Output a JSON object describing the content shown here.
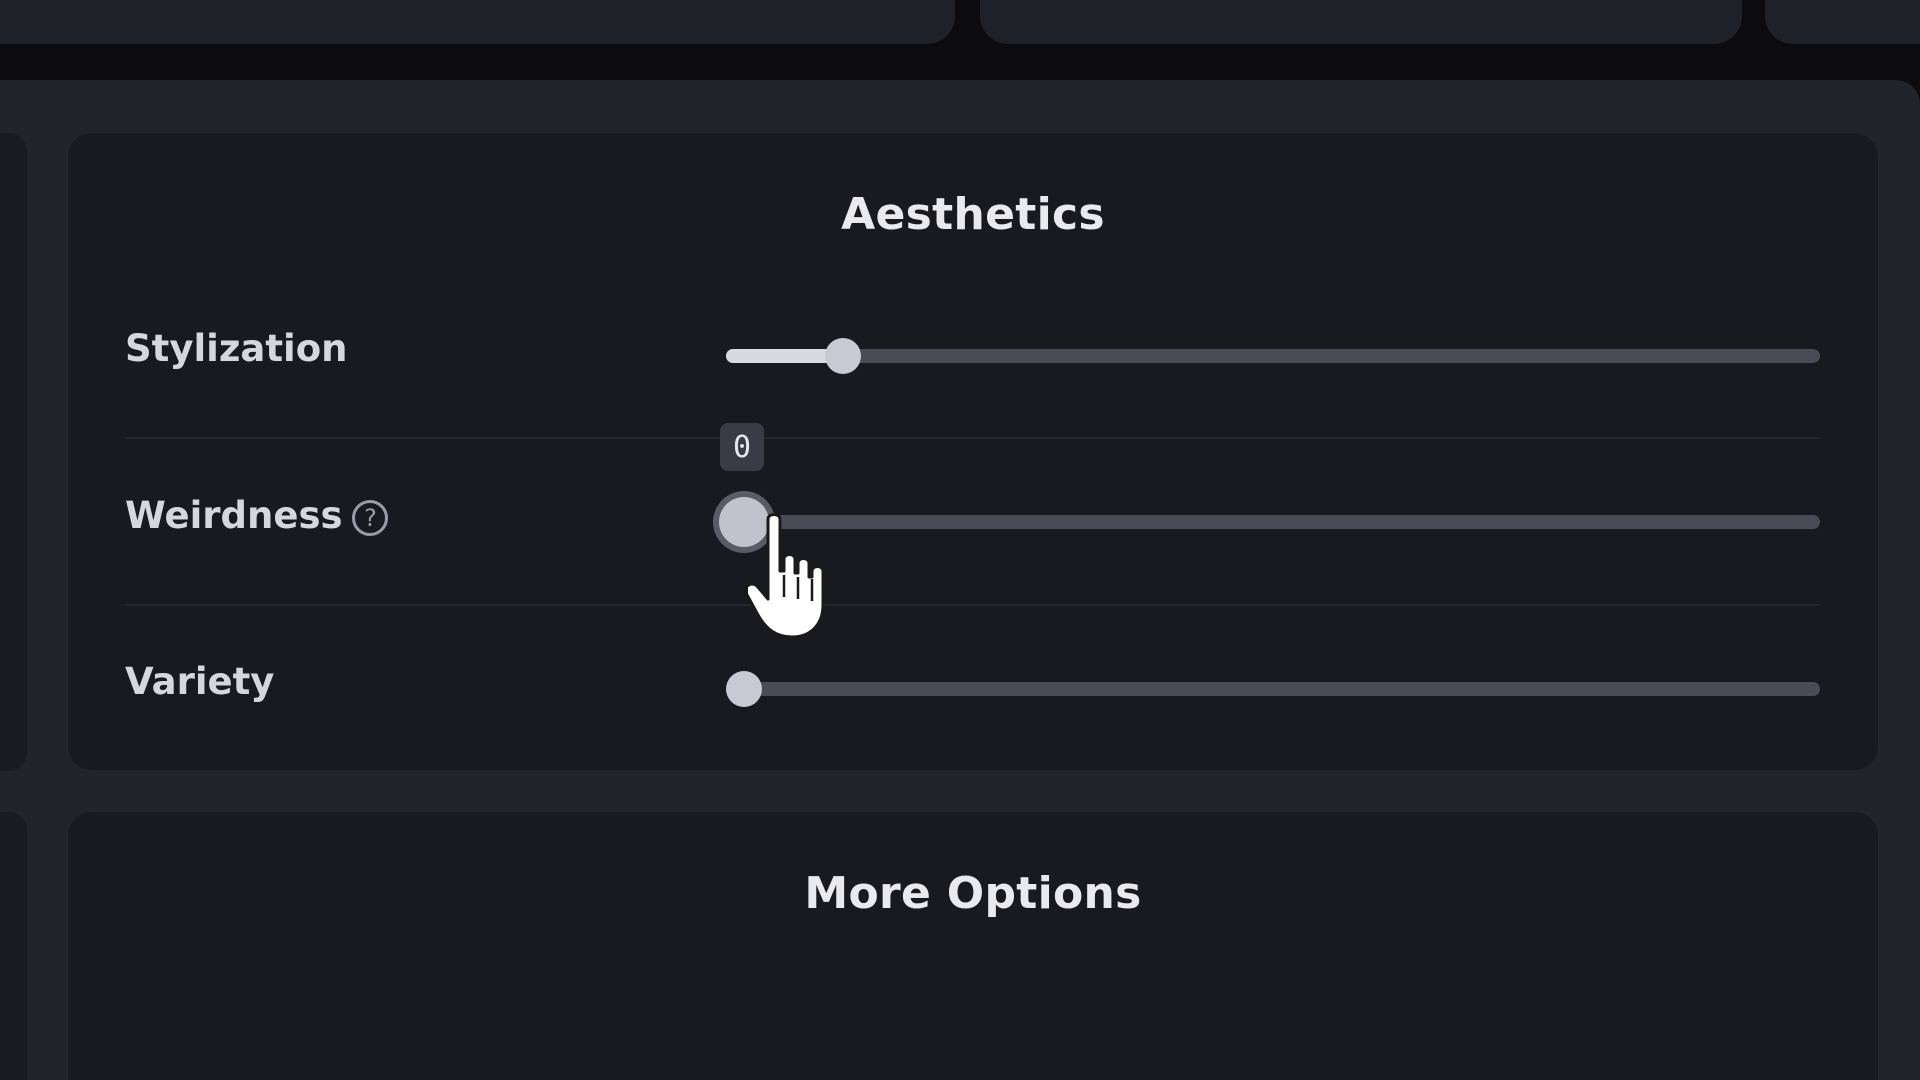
{
  "aesthetics": {
    "title": "Aesthetics",
    "sliders": [
      {
        "label": "Stylization",
        "value_fraction": 0.1,
        "has_help": false,
        "filled": true
      },
      {
        "label": "Weirdness",
        "value_fraction": 0.0,
        "has_help": true,
        "help_glyph": "?",
        "tooltip": "0",
        "active": true
      },
      {
        "label": "Variety",
        "value_fraction": 0.0,
        "has_help": false
      }
    ]
  },
  "more_options": {
    "title": "More Options"
  },
  "colors": {
    "background": "#0b0b10",
    "card": "#191a20",
    "track": "#4a4b54",
    "thumb": "#c9c9d3",
    "fill": "#d9d9e2"
  },
  "icons": {
    "help": "help-circle-icon",
    "cursor": "pointer-hand-icon"
  }
}
